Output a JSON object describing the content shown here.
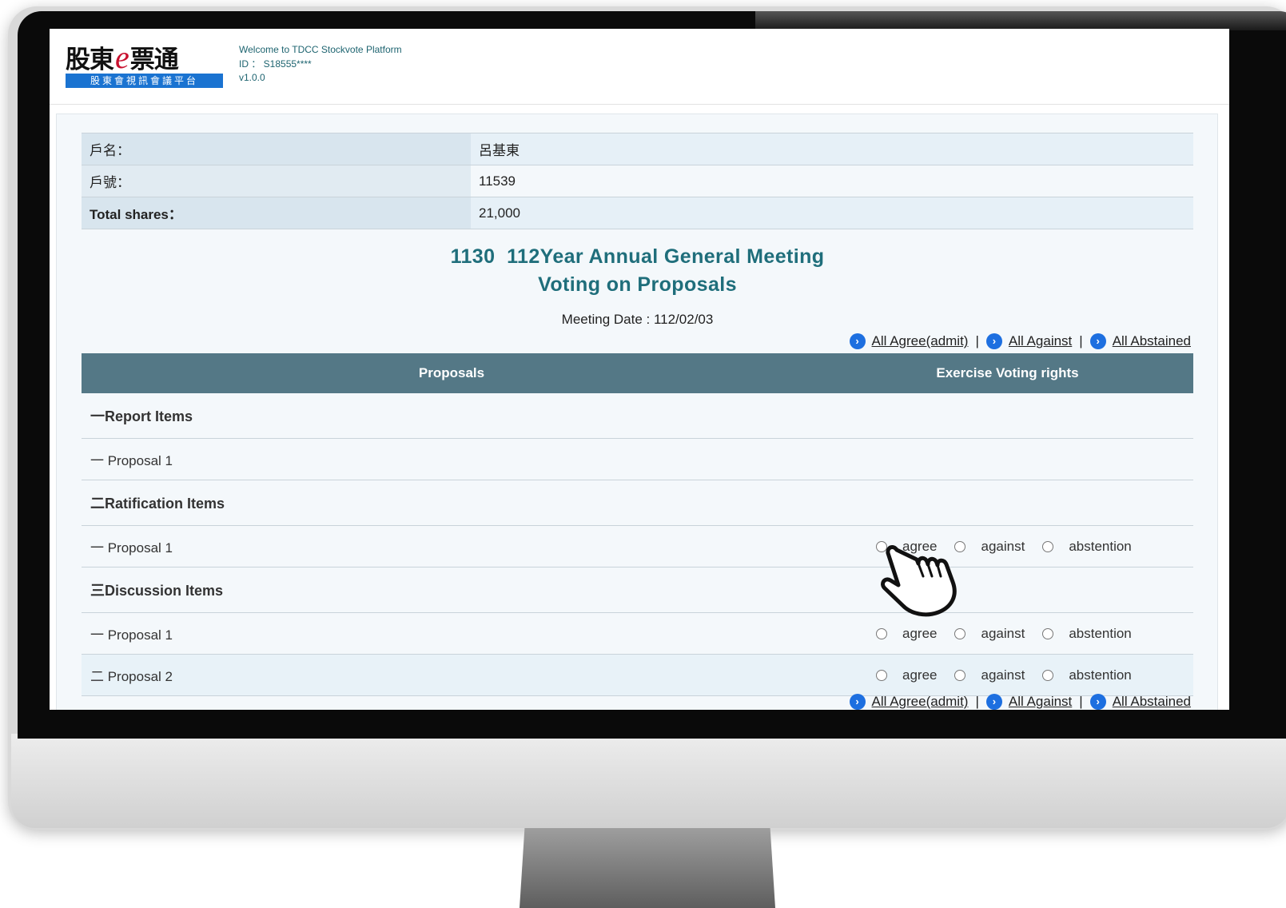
{
  "header": {
    "logo_main_left": "股東",
    "logo_e": "e",
    "logo_main_right": "票通",
    "logo_sub": "股東會視訊會議平台",
    "welcome": "Welcome to TDCC Stockvote Platform",
    "id_line": "ID ： S18555****",
    "version": "v1.0.0"
  },
  "account": {
    "rows": [
      {
        "key": "戶名：",
        "value": "呂基東"
      },
      {
        "key": "戶號：",
        "value": "11539"
      },
      {
        "key": "Total shares：",
        "value": "21,000"
      }
    ]
  },
  "meeting": {
    "title_line1": "1130  112Year Annual General Meeting",
    "title_line2": "Voting on Proposals",
    "date": "Meeting Date : 112/02/03"
  },
  "bulk": {
    "all_agree": "All Agree(admit)",
    "all_against": "All Against",
    "all_abstained": "All Abstained",
    "separator": "|",
    "icon": "chevron-right-circle-icon"
  },
  "table": {
    "col_proposals": "Proposals",
    "col_voting": "Exercise Voting rights",
    "rows": [
      {
        "type": "section",
        "label": "一Report Items"
      },
      {
        "type": "item",
        "label": "一 Proposal 1",
        "voting": false
      },
      {
        "type": "section",
        "label": "二Ratification Items"
      },
      {
        "type": "item",
        "label": "一 Proposal 1",
        "voting": true
      },
      {
        "type": "section",
        "label": "三Discussion Items"
      },
      {
        "type": "item",
        "label": "一 Proposal 1",
        "voting": true
      },
      {
        "type": "item",
        "label": "二 Proposal 2",
        "voting": true
      }
    ],
    "options": {
      "agree": "agree",
      "against": "against",
      "abstention": "abstention"
    }
  },
  "colors": {
    "table_header": "#547886",
    "title": "#1f6e7b",
    "link_icon": "#1d6fe0",
    "logo_sub_bg": "#1a73d1"
  }
}
